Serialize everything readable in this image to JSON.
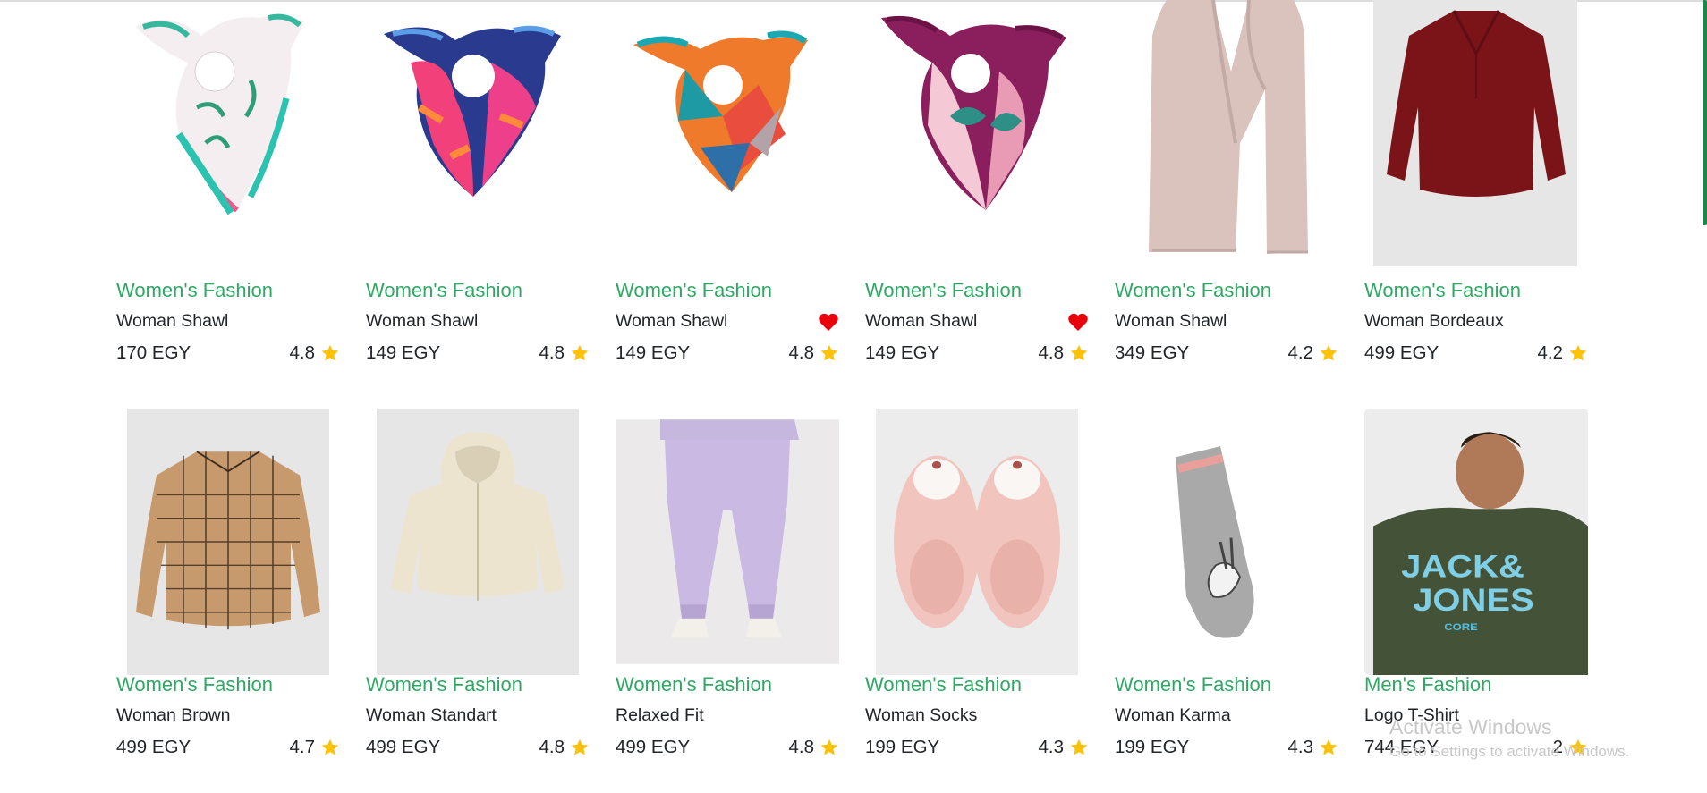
{
  "colors": {
    "category": "#2fa864",
    "heart": "#e8000b",
    "star": "#fdc107",
    "scroll": "#19874a"
  },
  "products": [
    {
      "category": "Women's Fashion",
      "name": "Woman Shawl",
      "price": "170 EGY",
      "rating": "4.8",
      "favorite": false,
      "image": "floral-white-teal-scarf"
    },
    {
      "category": "Women's Fashion",
      "name": "Woman Shawl",
      "price": "149 EGY",
      "rating": "4.8",
      "favorite": false,
      "image": "pink-navy-scarf"
    },
    {
      "category": "Women's Fashion",
      "name": "Woman Shawl",
      "price": "149 EGY",
      "rating": "4.8",
      "favorite": true,
      "image": "orange-teal-geometric-scarf"
    },
    {
      "category": "Women's Fashion",
      "name": "Woman Shawl",
      "price": "149 EGY",
      "rating": "4.8",
      "favorite": true,
      "image": "purple-pink-leaf-scarf"
    },
    {
      "category": "Women's Fashion",
      "name": "Woman Shawl",
      "price": "349 EGY",
      "rating": "4.2",
      "favorite": false,
      "image": "beige-long-scarf"
    },
    {
      "category": "Women's Fashion",
      "name": "Woman Bordeaux",
      "price": "499 EGY",
      "rating": "4.2",
      "favorite": false,
      "image": "bordeaux-blouse"
    },
    {
      "category": "Women's Fashion",
      "name": "Woman Brown",
      "price": "499 EGY",
      "rating": "4.7",
      "favorite": false,
      "image": "brown-plaid-shirt"
    },
    {
      "category": "Women's Fashion",
      "name": "Woman Standart",
      "price": "499 EGY",
      "rating": "4.8",
      "favorite": false,
      "image": "cream-hoodie"
    },
    {
      "category": "Women's Fashion",
      "name": "Relaxed Fit",
      "price": "499 EGY",
      "rating": "4.8",
      "favorite": false,
      "image": "lilac-joggers"
    },
    {
      "category": "Women's Fashion",
      "name": "Woman Socks",
      "price": "199 EGY",
      "rating": "4.3",
      "favorite": false,
      "image": "pink-fuzzy-slipper-socks"
    },
    {
      "category": "Women's Fashion",
      "name": "Woman Karma",
      "price": "199 EGY",
      "rating": "4.3",
      "favorite": false,
      "image": "grey-bunny-sock"
    },
    {
      "category": "Men's Fashion",
      "name": "Logo T-Shirt",
      "price": "744 EGY",
      "rating": "2",
      "favorite": false,
      "image": "jack-jones-tshirt"
    }
  ],
  "jack_jones_print": {
    "line1": "JACK&",
    "line2": "JONES",
    "line3": "CORE"
  },
  "watermark": {
    "title": "Activate Windows",
    "subtitle": "Go to Settings to activate Windows."
  }
}
